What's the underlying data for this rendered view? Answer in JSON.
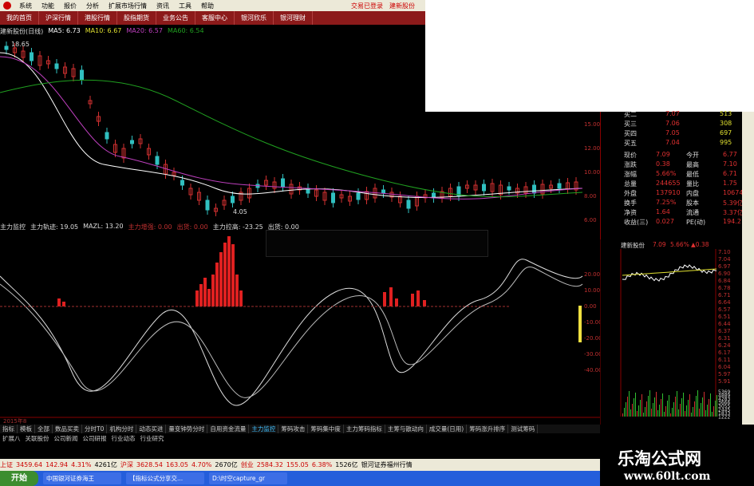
{
  "menubar": {
    "items": [
      "系统",
      "功能",
      "报价",
      "分析",
      "扩展市场行情",
      "资讯",
      "工具",
      "帮助"
    ],
    "right_buttons": [
      "交易已登录",
      "建新股份"
    ]
  },
  "navbar": {
    "items": [
      "我的首页",
      "沪深行情",
      "港股行情",
      "股指期货",
      "业务公告",
      "客服中心",
      "银河欣乐",
      "银河理财"
    ]
  },
  "ma_legend": {
    "title": "建新股份(日线)",
    "ma5": "MA5: 6.73",
    "ma10": "MA10: 6.67",
    "ma20": "MA20: 6.57",
    "ma60": "MA60: 6.54"
  },
  "chart_labels": {
    "high_price": "18.65",
    "low_price": "4.05"
  },
  "chart_colors": {
    "ma5": "#ffffff",
    "ma10": "#e0e030",
    "ma20": "#c040c0",
    "ma60": "#20a020"
  },
  "indicator_legend": {
    "main": "主力监控",
    "track": "主力轨迹: 19.05",
    "mazl": "MAZL: 13.20",
    "bull": "主力增强: 0.00",
    "sell": "出货: 0.00",
    "pull": "主力拉高: -23.25",
    "out": "出货: 0.00"
  },
  "quote_panel": {
    "rows": [
      {
        "label": "买二",
        "value": "7.07",
        "vol": "513"
      },
      {
        "label": "买三",
        "value": "7.06",
        "vol": "308"
      },
      {
        "label": "买四",
        "value": "7.05",
        "vol": "697"
      },
      {
        "label": "买五",
        "value": "7.04",
        "vol": "995"
      }
    ],
    "stats": [
      {
        "k1": "现价",
        "v1": "7.09",
        "k2": "今开",
        "v2": "6.77"
      },
      {
        "k1": "涨跌",
        "v1": "0.38",
        "k2": "最高",
        "v2": "7.10"
      },
      {
        "k1": "涨幅",
        "v1": "5.66%",
        "k2": "最低",
        "v2": "6.71"
      },
      {
        "k1": "总量",
        "v1": "244655",
        "k2": "量比",
        "v2": "1.75"
      },
      {
        "k1": "外盘",
        "v1": "137910",
        "k2": "内盘",
        "v2": "106745"
      },
      {
        "k1": "换手",
        "v1": "7.25%",
        "k2": "股本",
        "v2": "5.39亿"
      },
      {
        "k1": "净资",
        "v1": "1.64",
        "k2": "流通",
        "v2": "3.37亿"
      },
      {
        "k1": "收益(三)",
        "v1": "0.027",
        "k2": "PE(动)",
        "v2": "194.2"
      }
    ]
  },
  "mini_chart": {
    "title": "建新股份",
    "price": "7.09",
    "pct": "5.66%",
    "chg": "▲0.38",
    "ticks": [
      "7.10",
      "7.04",
      "6.97",
      "6.90",
      "6.84",
      "6.78",
      "6.71",
      "6.64",
      "6.57",
      "6.51",
      "6.44",
      "6.37",
      "6.31",
      "6.24",
      "6.17",
      "6.11",
      "6.04",
      "5.97",
      "5.91"
    ],
    "vol_ticks": [
      "5369",
      "4889",
      "4283",
      "3666",
      "3055",
      "2445",
      "1833",
      "1222"
    ]
  },
  "pct_axis": [
    "20.00",
    "10.00",
    "0.00",
    "-10.00",
    "-20.00",
    "-30.00",
    "-40.00"
  ],
  "price_axis": [
    "15.00",
    "12.00",
    "10.00",
    "8.00",
    "6.00"
  ],
  "tabs": [
    "指标",
    "模板",
    "全部",
    "数品买卖",
    "分时T0",
    "机构分时",
    "动态买进",
    "量变钟势分时",
    "自用资金流量",
    "主力监控",
    "筹码攻击",
    "筹码集中度",
    "主力筹码指标",
    "主筹与散动向",
    "成交量(日用)",
    "筹码涨升排序",
    "测试筹码"
  ],
  "active_tab": "主力监控",
  "tabs2": [
    "扩展八",
    "关联股份",
    "公司新闻",
    "公司研报",
    "行业动态",
    "行业研究"
  ],
  "date_labels": {
    "left": "2015年8",
    "right": "日线"
  },
  "status": {
    "sh": "上证",
    "sh_val": "3459.64",
    "sh_chg": "142.94",
    "sh_pct": "4.31%",
    "sh_amt": "4261亿",
    "sz": "沪深",
    "sz_val": "3628.54",
    "sz_chg": "163.05",
    "sz_pct": "4.70%",
    "sz_amt": "2670亿",
    "cy": "创业",
    "cy_val": "2584.32",
    "cy_chg": "155.05",
    "cy_pct": "6.38%",
    "cy_amt": "1526亿",
    "broker": "银河证券福州行情"
  },
  "taskbar": {
    "start": "开始",
    "tasks": [
      "中国银河证券海王",
      "【指标公式分享交...",
      "D:\\时空capture_gr"
    ]
  },
  "watermark": {
    "line1": "乐淘公式网",
    "line2": "www.60lt.com"
  }
}
